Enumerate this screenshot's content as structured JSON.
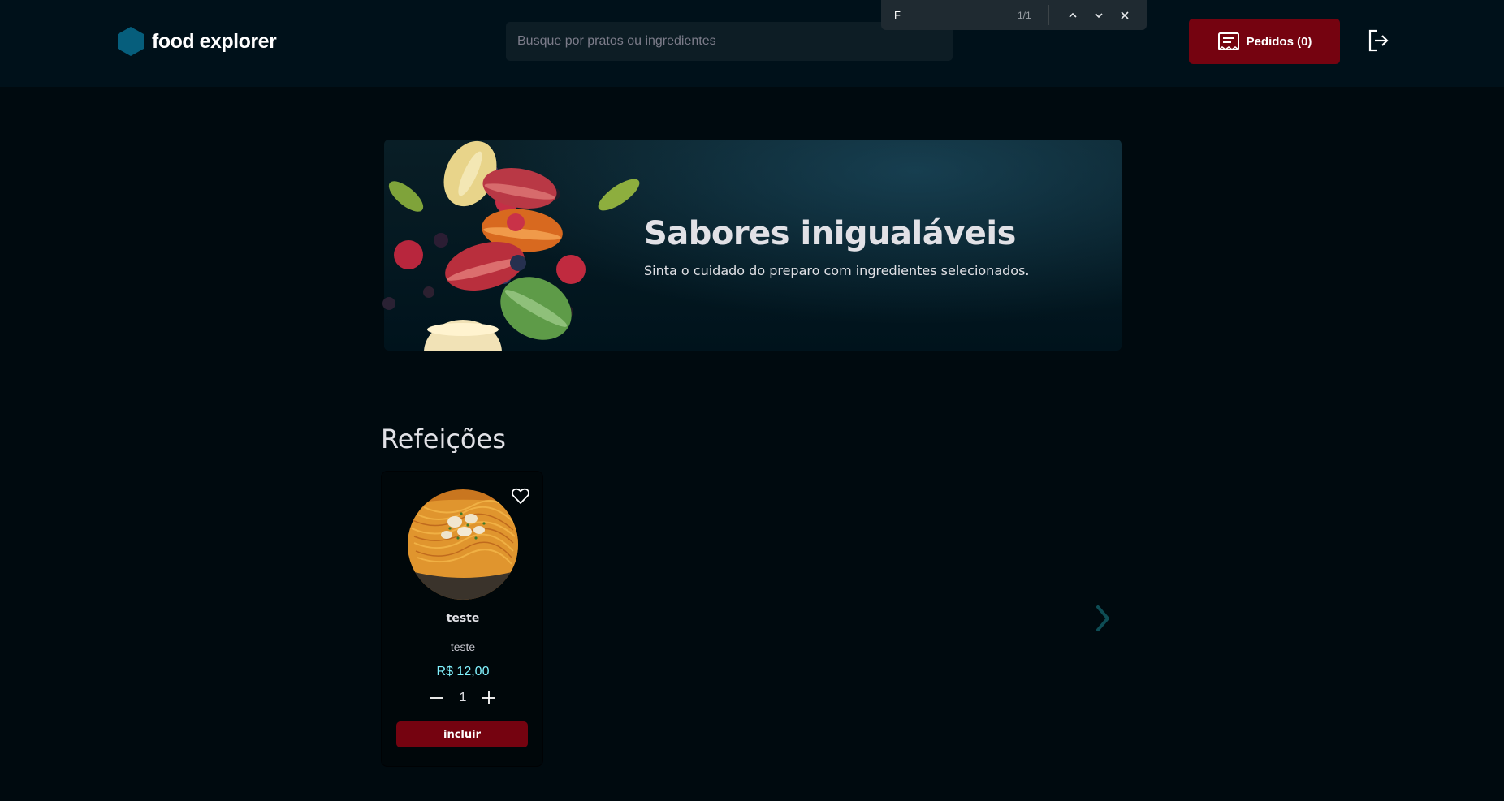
{
  "header": {
    "logo_text": "food explorer",
    "search_placeholder": "Busque por pratos ou ingredientes",
    "orders_label": "Pedidos (0)"
  },
  "find_bar": {
    "query": "F",
    "count": "1/1"
  },
  "banner": {
    "title": "Sabores inigualáveis",
    "subtitle": "Sinta o cuidado do preparo com ingredientes selecionados."
  },
  "section": {
    "title": "Refeições"
  },
  "dishes": [
    {
      "name": "teste",
      "description": "teste",
      "price": "R$ 12,00",
      "quantity": "1",
      "button_label": "incluir",
      "favorited": false
    }
  ],
  "colors": {
    "background": "#000A0F",
    "header": "#00111A",
    "accent_red": "#750310",
    "price_cyan": "#82F3FF",
    "logo_blue": "#065E7C",
    "carousel_arrow": "#0E4D55"
  },
  "icons": {
    "logo": "hexagon-logo-icon",
    "orders": "receipt-icon",
    "signout": "sign-out-icon",
    "favorite": "heart-outline-icon",
    "minus": "minus-icon",
    "plus": "plus-icon",
    "carousel_prev": "chevron-left-icon",
    "carousel_next": "chevron-right-icon"
  }
}
